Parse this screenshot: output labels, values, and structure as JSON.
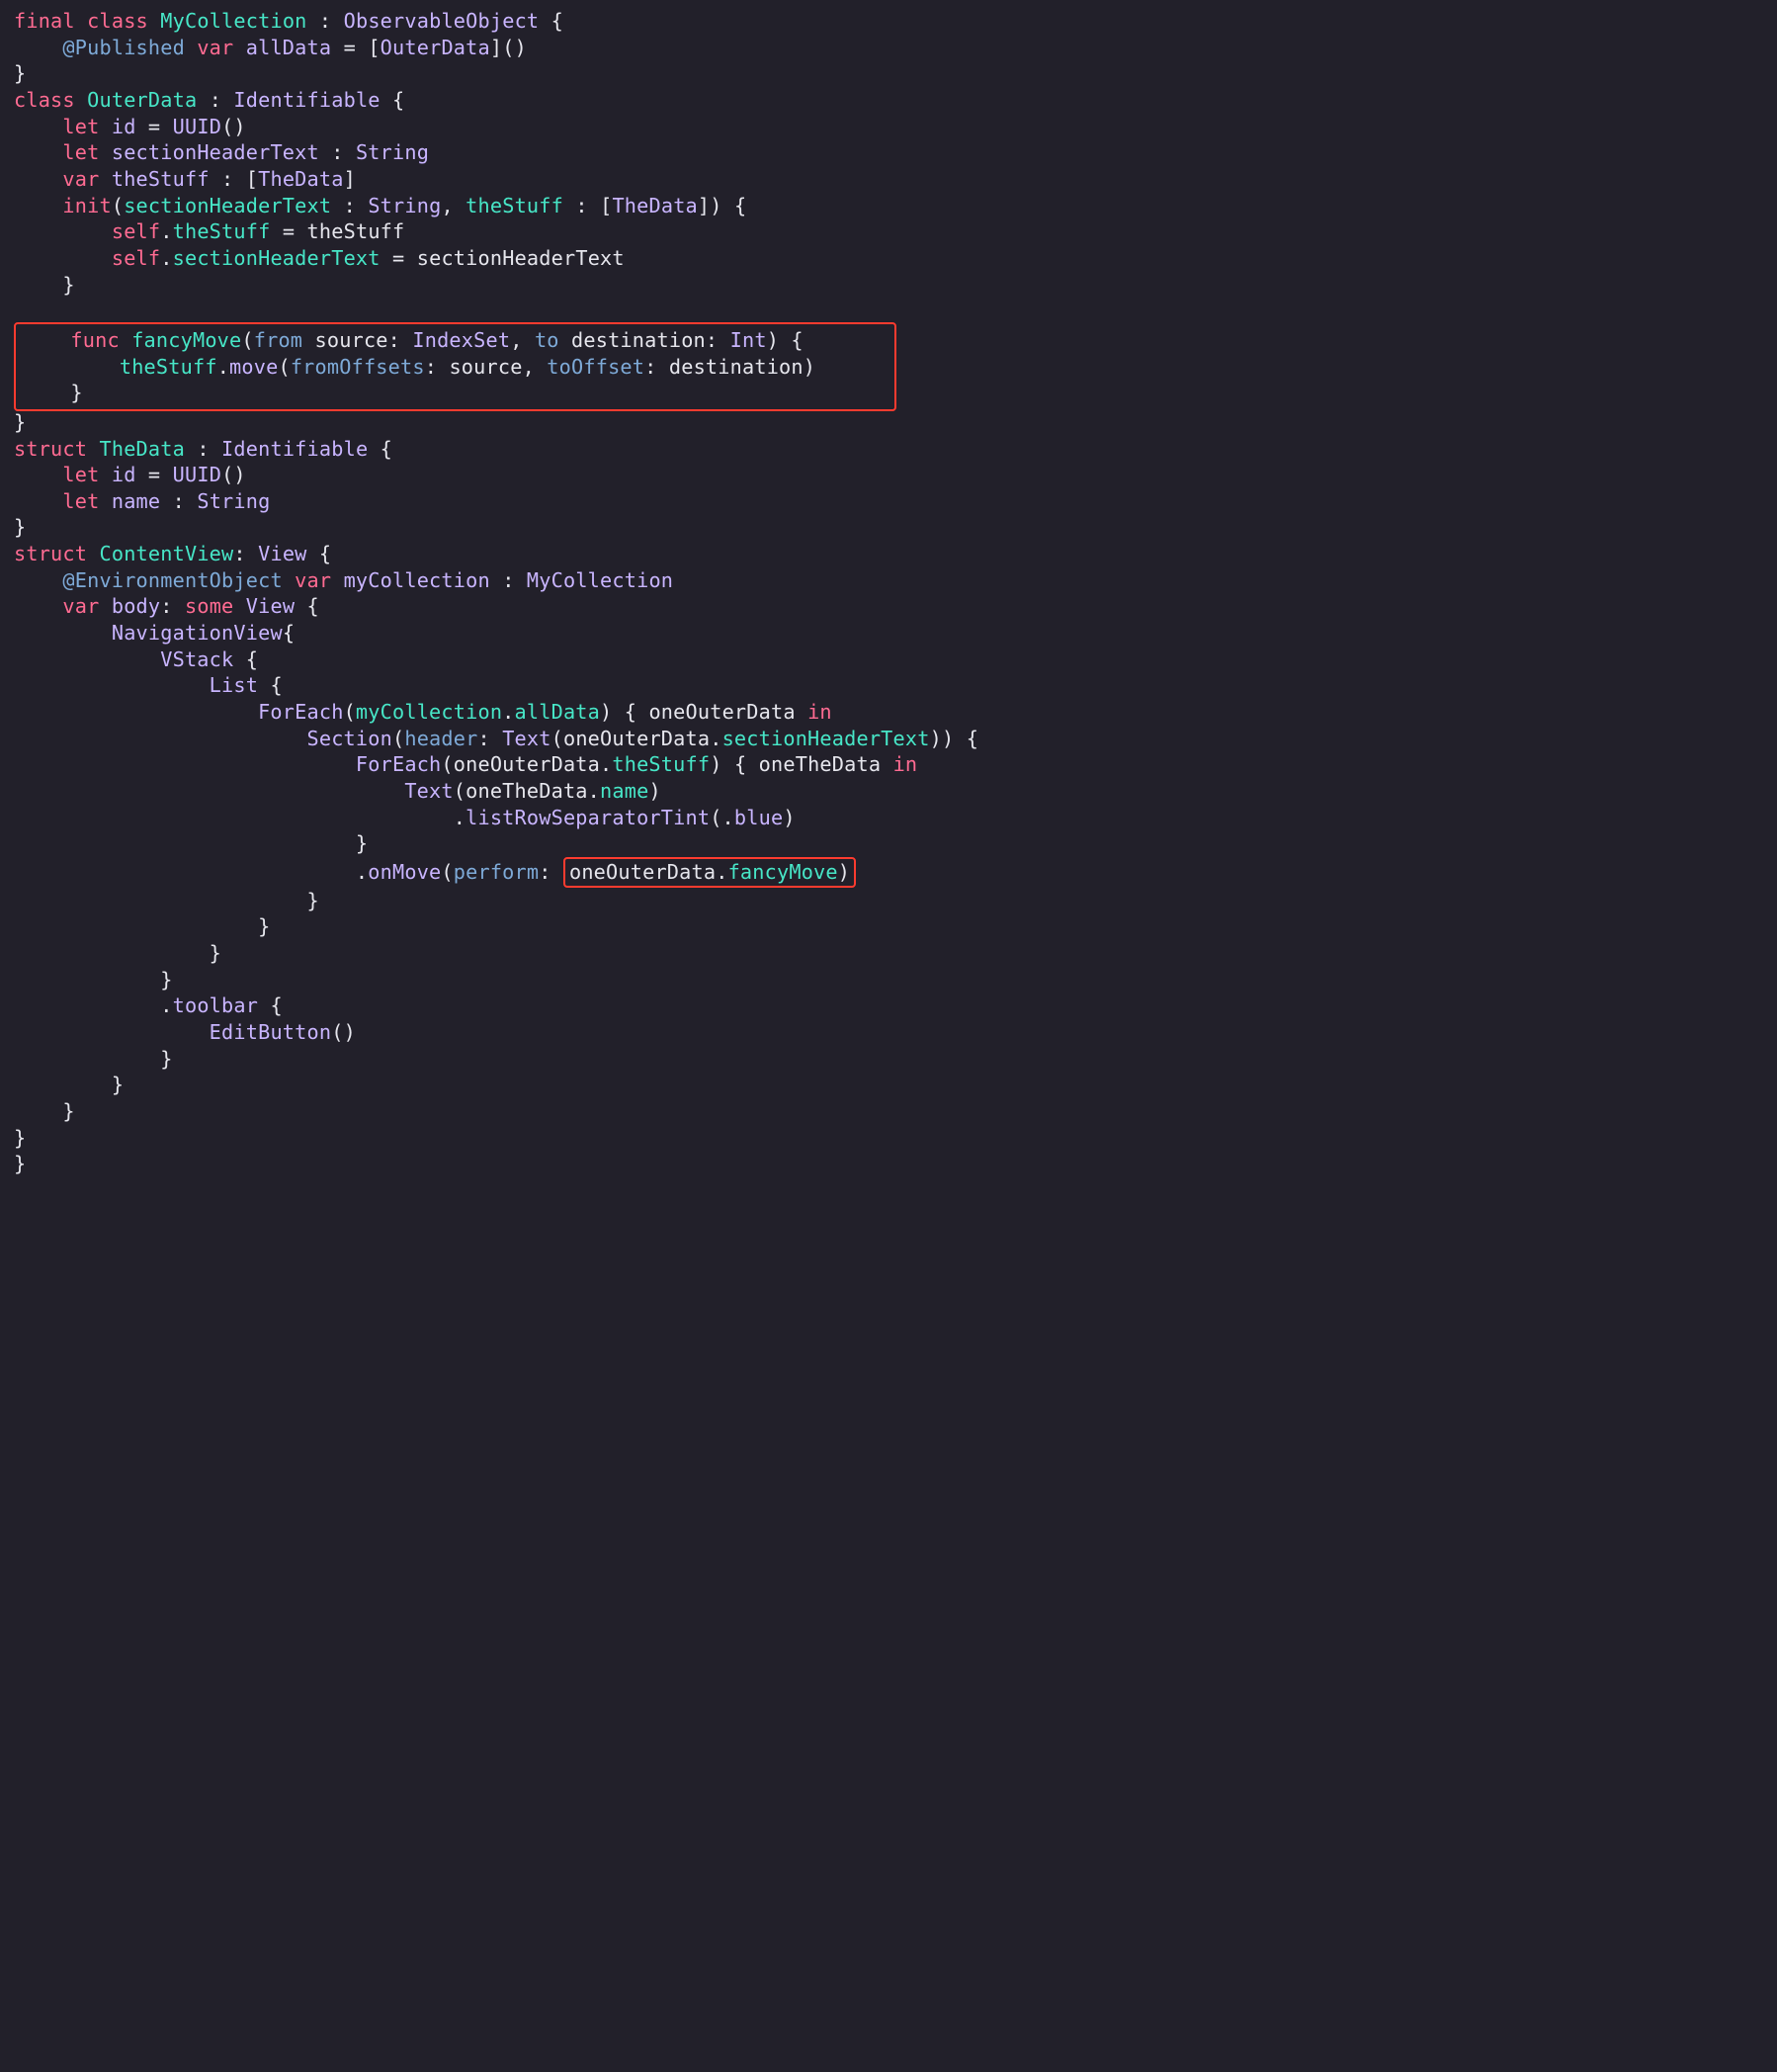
{
  "colors": {
    "background": "#22202a",
    "keyword": "#ff6b92",
    "type": "#47e6c7",
    "property": "#c9b5ff",
    "paramLabel": "#7eaad8",
    "default": "#e6e6ed",
    "highlightBorder": "#ff3b2f"
  },
  "tokens": {
    "t0": "final",
    "t1": "class",
    "t2": "MyCollection",
    "t3": ":",
    "t4": "ObservableObject",
    "t5": "{",
    "t6": "@Published",
    "t7": "var",
    "t8": "allData",
    "t9": "=",
    "t10": "[",
    "t11": "OuterData",
    "t12": "]",
    "t13": "()",
    "t14": "}",
    "t15": "class",
    "t16": "OuterData",
    "t17": ":",
    "t18": "Identifiable",
    "t19": "{",
    "t20": "let",
    "t21": "id",
    "t22": "=",
    "t23": "UUID",
    "t24": "()",
    "t25": "let",
    "t26": "sectionHeaderText",
    "t27": ":",
    "t28": "String",
    "t29": "var",
    "t30": "theStuff",
    "t31": ":",
    "t32": "[",
    "t33": "TheData",
    "t34": "]",
    "t35": "init",
    "t36": "(",
    "t37": "sectionHeaderText",
    "t38": ":",
    "t39": "String",
    "t40": ",",
    "t41": "theStuff",
    "t42": ":",
    "t43": "[",
    "t44": "TheData",
    "t45": "])",
    "t46": "{",
    "t47": "self",
    "t48": ".",
    "t49": "theStuff",
    "t50": "=",
    "t51": "theStuff",
    "t52": "self",
    "t53": ".",
    "t54": "sectionHeaderText",
    "t55": "=",
    "t56": "sectionHeaderText",
    "t57": "}",
    "t58": "func",
    "t59": "fancyMove",
    "t60": "(",
    "t61": "from",
    "t62": "source",
    "t63": ":",
    "t64": "IndexSet",
    "t65": ",",
    "t66": "to",
    "t67": "destination",
    "t68": ":",
    "t69": "Int",
    "t70": ")",
    "t71": "{",
    "t72": "theStuff",
    "t73": ".",
    "t74": "move",
    "t75": "(",
    "t76": "fromOffsets",
    "t77": ":",
    "t78": "source",
    "t79": ",",
    "t80": "toOffset",
    "t81": ":",
    "t82": "destination",
    "t83": ")",
    "t84": "}",
    "t85": "}",
    "t86": "struct",
    "t87": "TheData",
    "t88": ":",
    "t89": "Identifiable",
    "t90": "{",
    "t91": "let",
    "t92": "id",
    "t93": "=",
    "t94": "UUID",
    "t95": "()",
    "t96": "let",
    "t97": "name",
    "t98": ":",
    "t99": "String",
    "t100": "}",
    "t101": "struct",
    "t102": "ContentView",
    "t103": ":",
    "t104": "View",
    "t105": "{",
    "t106": "@EnvironmentObject",
    "t107": "var",
    "t108": "myCollection",
    "t109": ":",
    "t110": "MyCollection",
    "t111": "var",
    "t112": "body",
    "t113": ":",
    "t114": "some",
    "t115": "View",
    "t116": "{",
    "t117": "NavigationView",
    "t118": "{",
    "t119": "VStack",
    "t120": "{",
    "t121": "List",
    "t122": "{",
    "t123": "ForEach",
    "t124": "(",
    "t125": "myCollection",
    "t126": ".",
    "t127": "allData",
    "t128": ")",
    "t129": "{",
    "t130": "oneOuterData",
    "t131": "in",
    "t132": "Section",
    "t133": "(",
    "t134": "header",
    "t135": ":",
    "t136": "Text",
    "t137": "(",
    "t138": "oneOuterData",
    "t139": ".",
    "t140": "sectionHeaderText",
    "t141": "))",
    "t142": "{",
    "t143": "ForEach",
    "t144": "(",
    "t145": "oneOuterData",
    "t146": ".",
    "t147": "theStuff",
    "t148": ")",
    "t149": "{",
    "t150": "oneTheData",
    "t151": "in",
    "t152": "Text",
    "t153": "(",
    "t154": "oneTheData",
    "t155": ".",
    "t156": "name",
    "t157": ")",
    "t158": ".",
    "t159": "listRowSeparatorTint",
    "t160": "(",
    "t161": ".",
    "t162": "blue",
    "t163": ")",
    "t164": "}",
    "t165": ".",
    "t166": "onMove",
    "t167": "(",
    "t168": "perform",
    "t169": ":",
    "t170": "oneOuterData",
    "t171": ".",
    "t172": "fancyMove",
    "t173": ")",
    "t174": "}",
    "t175": "}",
    "t176": "}",
    "t177": "}",
    "t178": ".",
    "t179": "toolbar",
    "t180": "{",
    "t181": "EditButton",
    "t182": "()",
    "t183": "}",
    "t184": "}",
    "t185": "}",
    "t186": "}",
    "t187": "}"
  }
}
